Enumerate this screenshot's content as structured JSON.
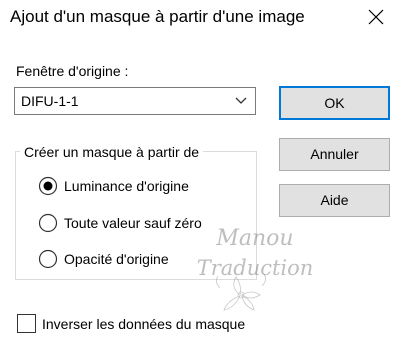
{
  "window": {
    "title": "Ajout d'un masque à partir d'une image",
    "close_icon": "close-icon"
  },
  "source": {
    "label": "Fenêtre d'origine :",
    "selected": "DIFU-1-1"
  },
  "buttons": {
    "ok": "OK",
    "cancel": "Annuler",
    "help": "Aide"
  },
  "group": {
    "legend": "Créer un masque à partir de",
    "options": [
      {
        "label": "Luminance d'origine",
        "checked": true
      },
      {
        "label": "Toute valeur sauf zéro",
        "checked": false
      },
      {
        "label": "Opacité d'origine",
        "checked": false
      }
    ]
  },
  "invert": {
    "label": "Inverser les données du masque",
    "checked": false
  },
  "watermark": {
    "line1": "Manou",
    "line2": "Traduction"
  },
  "colors": {
    "accent": "#0078d7",
    "button_bg": "#e1e1e1"
  }
}
